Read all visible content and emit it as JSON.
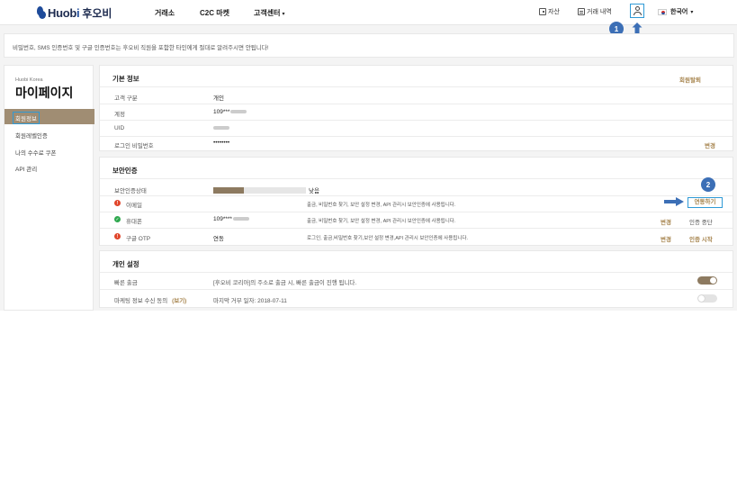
{
  "header": {
    "logo_text_a": "Huob",
    "logo_text_b": "i",
    "logo_korean": "후오비",
    "nav": [
      {
        "label": "거래소"
      },
      {
        "label": "C2C 마켓"
      },
      {
        "label": "고객센터"
      }
    ],
    "nav_caret": "▾",
    "assets_label": "자산",
    "history_label": "거래 내역",
    "language_label": "한국어",
    "language_caret": "▾"
  },
  "markers": {
    "step1": "1",
    "step2": "2"
  },
  "notice": {
    "text": "비밀번호, SMS 인증번호 및 구글 인증번호는 후오비 직원을 포함한 타인에게 절대로 알려주시면 안됩니다!"
  },
  "sidebar": {
    "brand_small": "Huobi Korea",
    "title": "마이페이지",
    "active_item": "회원정보",
    "items": [
      {
        "label": "회원레벨인증"
      },
      {
        "label": "나의 수수료 쿠폰"
      },
      {
        "label": "API 관리"
      }
    ]
  },
  "basic_info": {
    "title": "기본 정보",
    "withdraw_link": "회원탈퇴",
    "rows": [
      {
        "label": "고객 구분",
        "value": "개인"
      },
      {
        "label": "계정",
        "value": "109***"
      },
      {
        "label": "UID",
        "value": ""
      },
      {
        "label": "로그인 비밀번호",
        "value": "••••••••"
      }
    ],
    "change_link": "변경"
  },
  "security": {
    "title": "보안인증",
    "status_label": "보안인증상태",
    "level_text": "낮음",
    "level_fraction": 0.33,
    "rows": [
      {
        "label": "이메일",
        "value": "",
        "desc": "출금, 비밀번호 찾기, 보안 설정 변경, API 관리시 보안인증에 사용됩니다.",
        "status": "red",
        "action_a": "",
        "action_b": "연동하기"
      },
      {
        "label": "휴대폰",
        "value": "109****",
        "desc": "출금, 비밀번호 찾기, 보안 설정 변경, API 관리시 보안인증에 사용됩니다.",
        "status": "green",
        "action_a": "변경",
        "action_b": "인증 중단"
      },
      {
        "label": "구글 OTP",
        "value": "연동",
        "desc": "로그인, 출금,비밀번호 찾기,보안 설정 변경,API 관리시 보안인증에 사용됩니다.",
        "status": "red",
        "action_a": "변경",
        "action_b": "인증 시작"
      }
    ]
  },
  "personal": {
    "title": "개인 설정",
    "rows": [
      {
        "label": "빠른 출금",
        "label_extra": "",
        "desc": "[후오비 코리아]의 주소로 출금 시, 빠른 출금이 진행 됩니다.",
        "toggle": true
      },
      {
        "label": "마케팅 정보 수신 동의",
        "label_extra": "(보기)",
        "desc": "마지막 거부 일자: 2018-07-11",
        "toggle": false
      }
    ]
  },
  "colors": {
    "accent_gold": "#a7854f",
    "sidebar_active": "#a08d73",
    "highlight_blue": "#2f9ad6",
    "marker_blue": "#3c6fb6",
    "status_red": "#e0452a",
    "status_green": "#2fa84f"
  }
}
